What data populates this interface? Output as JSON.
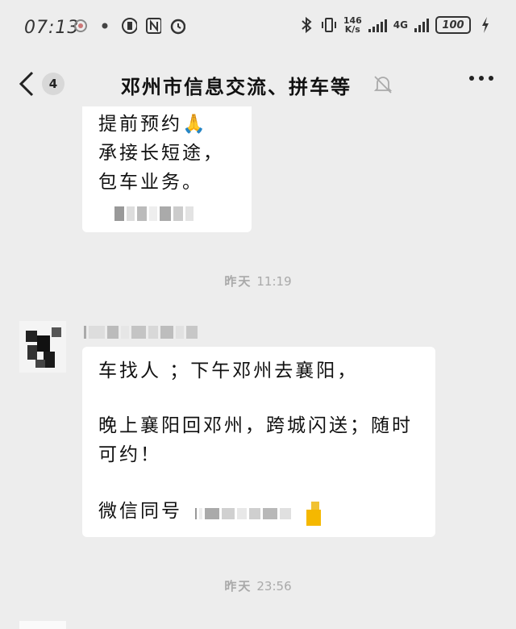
{
  "status_bar": {
    "time": "07:13",
    "net_speed_value": "146",
    "net_speed_unit": "K/s",
    "network": "4G",
    "battery": "100"
  },
  "nav": {
    "unread_count": "4",
    "title": "邓州市信息交流、拼车等"
  },
  "messages": {
    "first": {
      "lines": [
        "提前预约",
        "承接长短途，",
        "包车业务。"
      ],
      "emoji": "🙏"
    },
    "timestamp_1": {
      "day": "昨天",
      "time": "11:19"
    },
    "second": {
      "line1": "车找人 ；下午邓州去襄阳，",
      "line2": "晚上襄阳回邓州，跨城闪送；随时",
      "line3": "可约！",
      "line4": "微信同号"
    },
    "timestamp_2": {
      "day": "昨天",
      "time": "23:56"
    }
  },
  "colors": {
    "background": "#ededed",
    "bubble": "#ffffff",
    "timestamp": "#a9a9a9"
  }
}
